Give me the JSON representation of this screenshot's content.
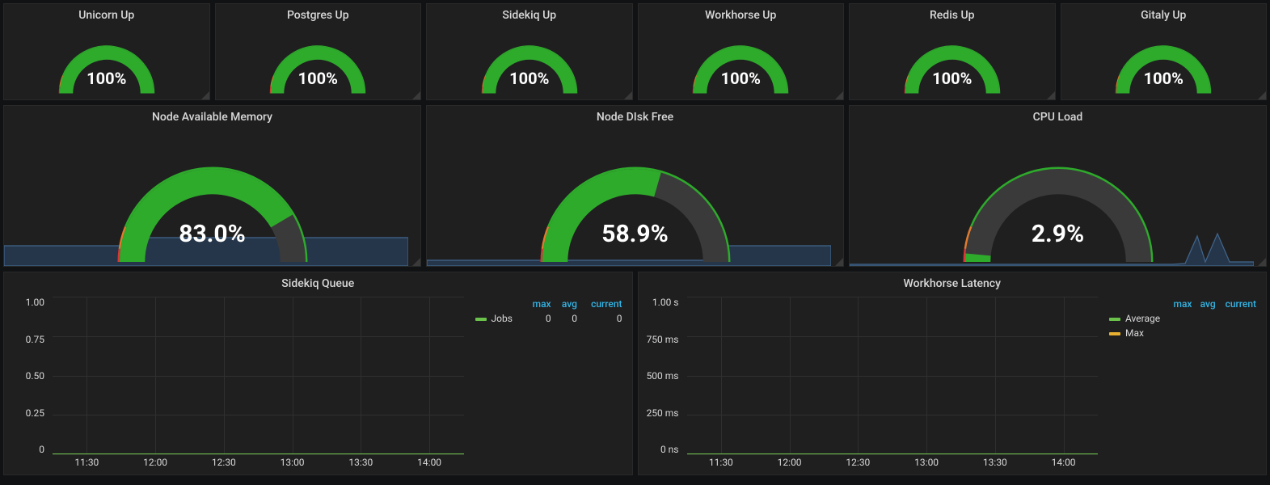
{
  "status_gauges": [
    {
      "id": "unicorn",
      "title": "Unicorn Up",
      "value": 100,
      "label": "100%"
    },
    {
      "id": "postgres",
      "title": "Postgres Up",
      "value": 100,
      "label": "100%"
    },
    {
      "id": "sidekiq",
      "title": "Sidekiq Up",
      "value": 100,
      "label": "100%"
    },
    {
      "id": "workhorse",
      "title": "Workhorse Up",
      "value": 100,
      "label": "100%"
    },
    {
      "id": "redis",
      "title": "Redis Up",
      "value": 100,
      "label": "100%"
    },
    {
      "id": "gitaly",
      "title": "Gitaly Up",
      "value": 100,
      "label": "100%"
    }
  ],
  "big_gauges": [
    {
      "id": "memory",
      "title": "Node Available Memory",
      "value": 83.0,
      "label": "83.0%"
    },
    {
      "id": "disk",
      "title": "Node DIsk Free",
      "value": 58.9,
      "label": "58.9%"
    },
    {
      "id": "cpu",
      "title": "CPU Load",
      "value": 2.9,
      "label": "2.9%"
    }
  ],
  "charts": [
    {
      "id": "sidekiq-queue",
      "title": "Sidekiq Queue",
      "legend_headers": [
        "max",
        "avg",
        "current"
      ],
      "series": [
        {
          "name": "Jobs",
          "color": "#6ac24b",
          "max": "0",
          "avg": "0",
          "current": "0"
        }
      ],
      "y_ticks": [
        "1.00",
        "0.75",
        "0.50",
        "0.25",
        "0"
      ],
      "x_ticks": [
        "11:30",
        "12:00",
        "12:30",
        "13:00",
        "13:30",
        "14:00"
      ]
    },
    {
      "id": "workhorse-latency",
      "title": "Workhorse Latency",
      "legend_headers": [
        "max",
        "avg",
        "current"
      ],
      "series": [
        {
          "name": "Average",
          "color": "#6ac24b",
          "max": "",
          "avg": "",
          "current": ""
        },
        {
          "name": "Max",
          "color": "#e8b030",
          "max": "",
          "avg": "",
          "current": ""
        }
      ],
      "y_ticks": [
        "1.00 s",
        "750 ms",
        "500 ms",
        "250 ms",
        "0 ns"
      ],
      "x_ticks": [
        "11:30",
        "12:00",
        "12:30",
        "13:00",
        "13:30",
        "14:00"
      ]
    }
  ],
  "colors": {
    "gauge_green": "#2eab2b",
    "gauge_orange": "#e07b2e",
    "gauge_red": "#d93636",
    "gauge_track": "#3a3a3a",
    "spark_stroke": "#41668c",
    "spark_fill": "#26364a"
  },
  "chart_data": [
    {
      "type": "line",
      "title": "Sidekiq Queue",
      "xlabel": "",
      "ylabel": "",
      "ylim": [
        0,
        1
      ],
      "x": [
        "11:30",
        "12:00",
        "12:30",
        "13:00",
        "13:30",
        "14:00"
      ],
      "series": [
        {
          "name": "Jobs",
          "values": [
            0,
            0,
            0,
            0,
            0,
            0
          ]
        }
      ]
    },
    {
      "type": "line",
      "title": "Workhorse Latency",
      "xlabel": "",
      "ylabel": "",
      "ylim": [
        0,
        1000
      ],
      "y_unit": "ms",
      "x": [
        "11:30",
        "12:00",
        "12:30",
        "13:00",
        "13:30",
        "14:00"
      ],
      "series": [
        {
          "name": "Average",
          "values": [
            0,
            0,
            0,
            0,
            0,
            0
          ]
        },
        {
          "name": "Max",
          "values": [
            0,
            0,
            0,
            0,
            0,
            0
          ]
        }
      ]
    }
  ]
}
